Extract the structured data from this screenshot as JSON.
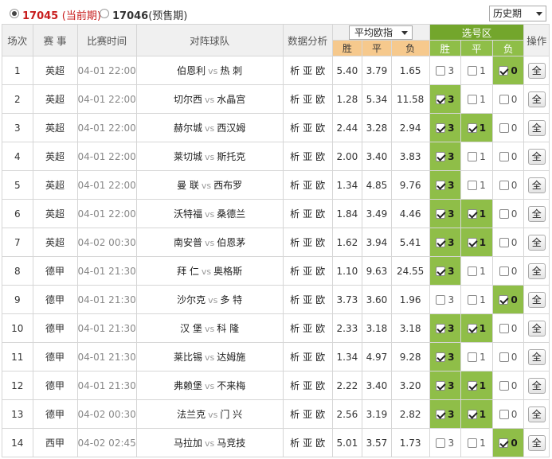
{
  "periods": {
    "current": {
      "code": "17045",
      "note": "(当前期)",
      "selected": true
    },
    "next": {
      "code": "17046",
      "note": "(预售期)",
      "selected": false
    }
  },
  "history_select": "历史期",
  "odds_select": "平均欧指",
  "headers": {
    "no": "场次",
    "league": "赛 事",
    "time": "比赛时间",
    "teams": "对阵球队",
    "analysis": "数据分析",
    "select_zone": "选号区",
    "ops": "操作",
    "win": "胜",
    "draw": "平",
    "lose": "负",
    "pick_win": "胜",
    "pick_draw": "平",
    "pick_lose": "负"
  },
  "vs_label": "vs",
  "analysis_labels": [
    "析",
    "亚",
    "欧"
  ],
  "all_label": "全",
  "rows": [
    {
      "no": "1",
      "league": "英超",
      "time": "04-01 22:00",
      "home": "伯恩利",
      "away": "热 刺",
      "w": "5.40",
      "d": "3.79",
      "l": "1.65",
      "picks": [
        false,
        false,
        true
      ]
    },
    {
      "no": "2",
      "league": "英超",
      "time": "04-01 22:00",
      "home": "切尔西",
      "away": "水晶宫",
      "w": "1.28",
      "d": "5.34",
      "l": "11.58",
      "picks": [
        true,
        false,
        false
      ]
    },
    {
      "no": "3",
      "league": "英超",
      "time": "04-01 22:00",
      "home": "赫尔城",
      "away": "西汉姆",
      "w": "2.44",
      "d": "3.28",
      "l": "2.94",
      "picks": [
        true,
        true,
        false
      ]
    },
    {
      "no": "4",
      "league": "英超",
      "time": "04-01 22:00",
      "home": "莱切城",
      "away": "斯托克",
      "w": "2.00",
      "d": "3.40",
      "l": "3.83",
      "picks": [
        true,
        false,
        false
      ]
    },
    {
      "no": "5",
      "league": "英超",
      "time": "04-01 22:00",
      "home": "曼 联",
      "away": "西布罗",
      "w": "1.34",
      "d": "4.85",
      "l": "9.76",
      "picks": [
        true,
        false,
        false
      ]
    },
    {
      "no": "6",
      "league": "英超",
      "time": "04-01 22:00",
      "home": "沃特福",
      "away": "桑德兰",
      "w": "1.84",
      "d": "3.49",
      "l": "4.46",
      "picks": [
        true,
        true,
        false
      ]
    },
    {
      "no": "7",
      "league": "英超",
      "time": "04-02 00:30",
      "home": "南安普",
      "away": "伯恩茅",
      "w": "1.62",
      "d": "3.94",
      "l": "5.41",
      "picks": [
        true,
        true,
        false
      ]
    },
    {
      "no": "8",
      "league": "德甲",
      "time": "04-01 21:30",
      "home": "拜 仁",
      "away": "奥格斯",
      "w": "1.10",
      "d": "9.63",
      "l": "24.55",
      "picks": [
        true,
        false,
        false
      ]
    },
    {
      "no": "9",
      "league": "德甲",
      "time": "04-01 21:30",
      "home": "沙尔克",
      "away": "多 特",
      "w": "3.73",
      "d": "3.60",
      "l": "1.96",
      "picks": [
        false,
        false,
        true
      ]
    },
    {
      "no": "10",
      "league": "德甲",
      "time": "04-01 21:30",
      "home": "汉 堡",
      "away": "科 隆",
      "w": "2.33",
      "d": "3.18",
      "l": "3.18",
      "picks": [
        true,
        true,
        false
      ]
    },
    {
      "no": "11",
      "league": "德甲",
      "time": "04-01 21:30",
      "home": "莱比锡",
      "away": "达姆施",
      "w": "1.34",
      "d": "4.97",
      "l": "9.28",
      "picks": [
        true,
        false,
        false
      ]
    },
    {
      "no": "12",
      "league": "德甲",
      "time": "04-01 21:30",
      "home": "弗赖堡",
      "away": "不来梅",
      "w": "2.22",
      "d": "3.40",
      "l": "3.20",
      "picks": [
        true,
        true,
        false
      ]
    },
    {
      "no": "13",
      "league": "德甲",
      "time": "04-02 00:30",
      "home": "法兰克",
      "away": "门 兴",
      "w": "2.56",
      "d": "3.19",
      "l": "2.82",
      "picks": [
        true,
        true,
        false
      ]
    },
    {
      "no": "14",
      "league": "西甲",
      "time": "04-02 02:45",
      "home": "马拉加",
      "away": "马竞技",
      "w": "5.01",
      "d": "3.57",
      "l": "1.73",
      "picks": [
        false,
        false,
        true
      ]
    }
  ],
  "colors": {
    "accent": "#73a62c",
    "pick_on": "#8fbe48",
    "odds_header": "#f6c98d",
    "current_period": "#c81d1d"
  }
}
